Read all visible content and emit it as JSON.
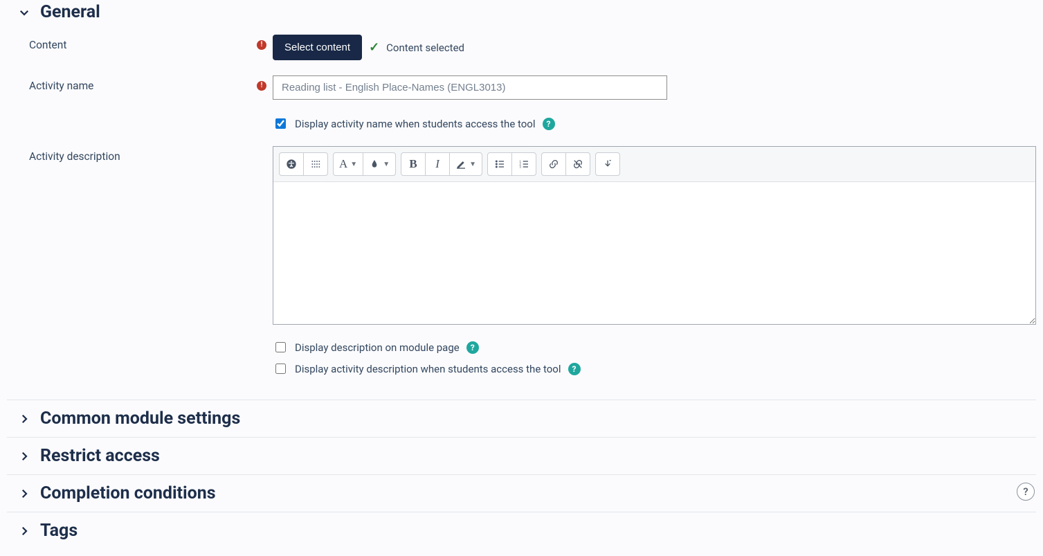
{
  "sections": {
    "general": {
      "title": "General",
      "expanded": true,
      "fields": {
        "content": {
          "label": "Content",
          "button_label": "Select content",
          "status_text": "Content selected"
        },
        "activity_name": {
          "label": "Activity name",
          "value": "Reading list - English Place-Names (ENGL3013)",
          "display_name_checkbox": {
            "label": "Display activity name when students access the tool",
            "checked": true
          }
        },
        "activity_description": {
          "label": "Activity description",
          "value": "",
          "display_on_module_checkbox": {
            "label": "Display description on module page",
            "checked": false
          },
          "display_desc_tool_checkbox": {
            "label": "Display activity description when students access the tool",
            "checked": false
          }
        }
      }
    },
    "common_module_settings": {
      "title": "Common module settings"
    },
    "restrict_access": {
      "title": "Restrict access"
    },
    "completion_conditions": {
      "title": "Completion conditions"
    },
    "tags": {
      "title": "Tags"
    }
  },
  "editor_toolbar": {
    "group1": [
      "accessibility",
      "grid"
    ],
    "group2": [
      "font-family",
      "font-color"
    ],
    "group3": [
      "bold",
      "italic",
      "highlight"
    ],
    "group4": [
      "bulleted-list",
      "numbered-list"
    ],
    "group5": [
      "link",
      "unlink"
    ],
    "group6": [
      "more"
    ]
  },
  "floating_help_label": "?"
}
